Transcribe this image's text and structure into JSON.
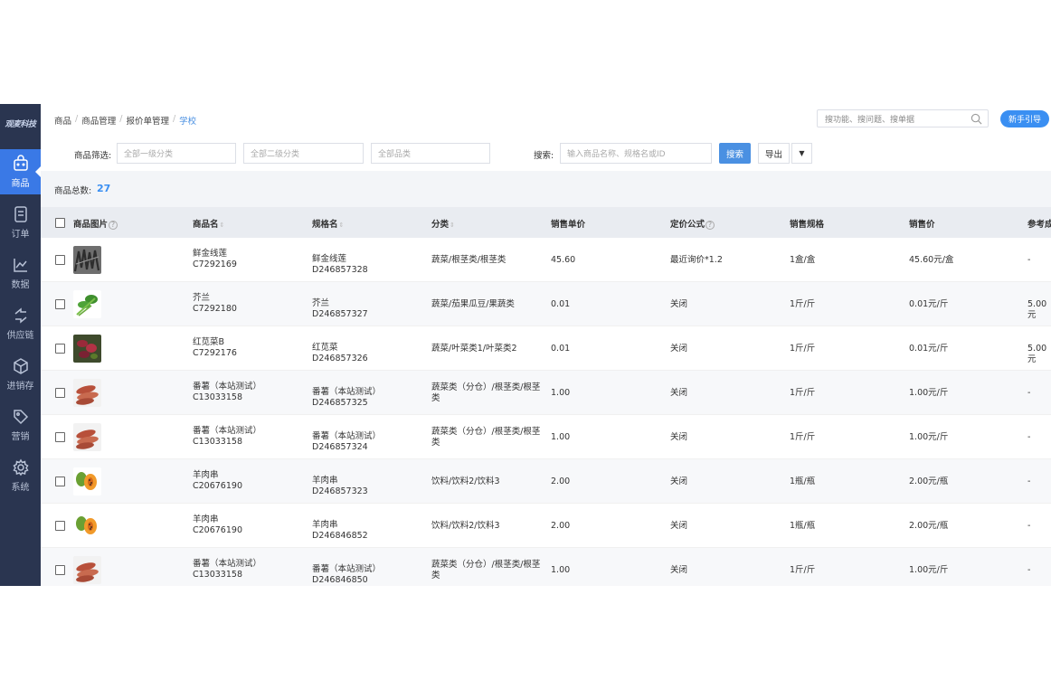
{
  "sidebar": {
    "logo": "观麦科技",
    "items": [
      {
        "label": "商品",
        "icon": "bag-icon",
        "active": true
      },
      {
        "label": "订单",
        "icon": "document-icon",
        "active": false
      },
      {
        "label": "数据",
        "icon": "line-chart-icon",
        "active": false
      },
      {
        "label": "供应链",
        "icon": "swap-arrows-icon",
        "active": false
      },
      {
        "label": "进销存",
        "icon": "box-icon",
        "active": false
      },
      {
        "label": "营销",
        "icon": "tag-icon",
        "active": false
      },
      {
        "label": "系统",
        "icon": "gear-icon",
        "active": false
      }
    ]
  },
  "header": {
    "breadcrumb": [
      "商品",
      "商品管理",
      "报价单管理",
      "学校"
    ],
    "search_placeholder": "搜功能、搜问题、搜单据",
    "guide_button": "新手引导"
  },
  "filter": {
    "label": "商品筛选:",
    "category1_placeholder": "全部一级分类",
    "category2_placeholder": "全部二级分类",
    "product_type_placeholder": "全部品类",
    "search_label": "搜索:",
    "search_placeholder": "输入商品名称、规格名或ID",
    "search_button": "搜索",
    "export_button": "导出",
    "caret": "▼"
  },
  "summary": {
    "label": "商品总数:",
    "count": "27"
  },
  "table": {
    "headers": {
      "image": "商品图片",
      "name": "商品名",
      "spec": "规格名",
      "category": "分类",
      "unit_price": "销售单价",
      "formula": "定价公式",
      "sale_spec": "销售规格",
      "sale_price": "销售价",
      "ref_cost": "参考成"
    },
    "help_glyph": "?",
    "sort_glyph": "⇕",
    "rows": [
      {
        "img": "dark-vegetable",
        "name": "鲜金线莲",
        "code": "C7292169",
        "spec_name": "鲜金线莲",
        "spec_id": "D246857328",
        "category": "蔬菜/根茎类/根茎类",
        "unit_price": "45.60",
        "formula": "最近询价*1.2",
        "sale_spec": "1盒/盒",
        "sale_price": "45.60元/盒",
        "ref": "-"
      },
      {
        "img": "green-vegetable",
        "name": "芥兰",
        "code": "C7292180",
        "spec_name": "芥兰",
        "spec_id": "D246857327",
        "category": "蔬菜/茄果瓜豆/果蔬类",
        "unit_price": "0.01",
        "formula": "关闭",
        "sale_spec": "1斤/斤",
        "sale_price": "0.01元/斤",
        "ref": "5.00元"
      },
      {
        "img": "red-vegetable",
        "name": "红苋菜B",
        "code": "C7292176",
        "spec_name": "红苋菜",
        "spec_id": "D246857326",
        "category": "蔬菜/叶菜类1/叶菜类2",
        "unit_price": "0.01",
        "formula": "关闭",
        "sale_spec": "1斤/斤",
        "sale_price": "0.01元/斤",
        "ref": "5.00元"
      },
      {
        "img": "sweet-potato",
        "name": "番薯（本站测试）",
        "code": "C13033158",
        "spec_name": "番薯（本站测试）",
        "spec_id": "D246857325",
        "category": "蔬菜类（分仓）/根茎类/根茎类",
        "unit_price": "1.00",
        "formula": "关闭",
        "sale_spec": "1斤/斤",
        "sale_price": "1.00元/斤",
        "ref": "-"
      },
      {
        "img": "sweet-potato",
        "name": "番薯（本站测试）",
        "code": "C13033158",
        "spec_name": "番薯（本站测试）",
        "spec_id": "D246857324",
        "category": "蔬菜类（分仓）/根茎类/根茎类",
        "unit_price": "1.00",
        "formula": "关闭",
        "sale_spec": "1斤/斤",
        "sale_price": "1.00元/斤",
        "ref": "-"
      },
      {
        "img": "papaya",
        "name": "羊肉串",
        "code": "C20676190",
        "spec_name": "羊肉串",
        "spec_id": "D246857323",
        "category": "饮料/饮料2/饮料3",
        "unit_price": "2.00",
        "formula": "关闭",
        "sale_spec": "1瓶/瓶",
        "sale_price": "2.00元/瓶",
        "ref": "-"
      },
      {
        "img": "papaya",
        "name": "羊肉串",
        "code": "C20676190",
        "spec_name": "羊肉串",
        "spec_id": "D246846852",
        "category": "饮料/饮料2/饮料3",
        "unit_price": "2.00",
        "formula": "关闭",
        "sale_spec": "1瓶/瓶",
        "sale_price": "2.00元/瓶",
        "ref": "-"
      },
      {
        "img": "sweet-potato",
        "name": "番薯（本站测试）",
        "code": "C13033158",
        "spec_name": "番薯（本站测试）",
        "spec_id": "D246846850",
        "category": "蔬菜类（分仓）/根茎类/根茎类",
        "unit_price": "1.00",
        "formula": "关闭",
        "sale_spec": "1斤/斤",
        "sale_price": "1.00元/斤",
        "ref": "-"
      }
    ]
  }
}
